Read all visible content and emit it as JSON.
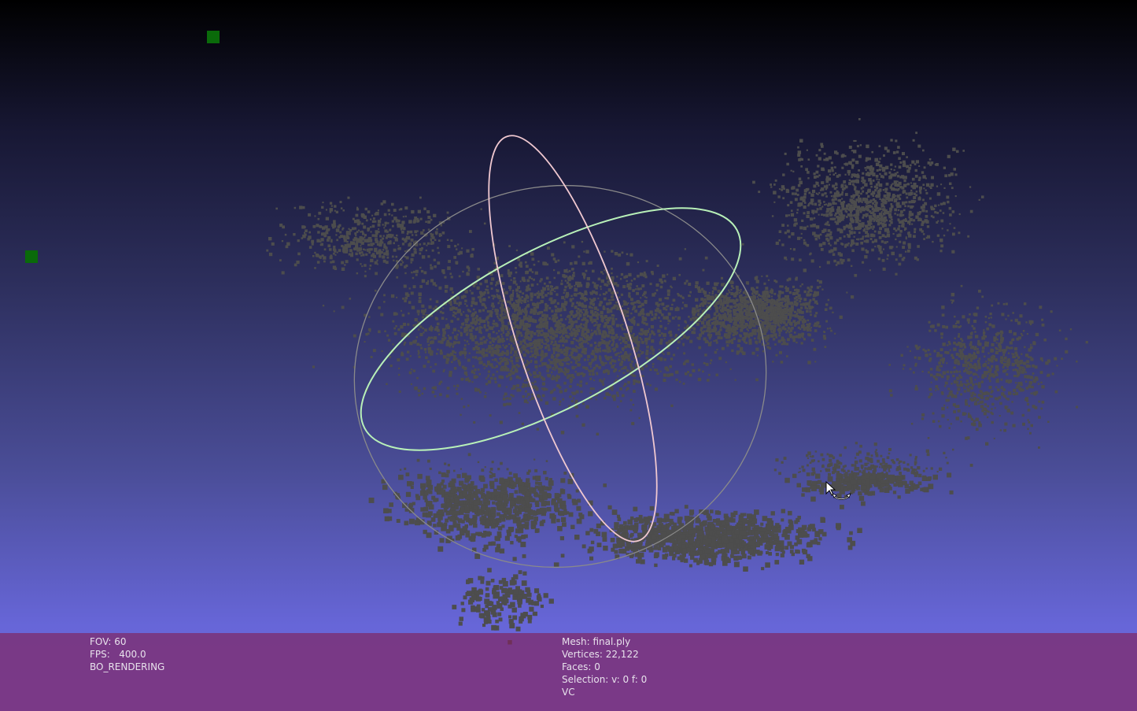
{
  "app": "MeshLab 3D viewer",
  "viewport": {
    "point_color": "#4d4d4d",
    "background_top": "#000000",
    "background_bottom": "#6e67dd",
    "trackball": {
      "horizontal_ring_color": "#b8f0b8",
      "vertical_ring_color": "#f0c8d0",
      "outer_ring_color": "#8a8a8a"
    },
    "camera_markers_color": "#0a6a0a",
    "cursor": "rotate-cursor-icon"
  },
  "info_left": {
    "fov": "FOV: 60",
    "fps": "FPS:   400.0",
    "mode": "BO_RENDERING"
  },
  "info_right": {
    "mesh": "Mesh: final.ply",
    "vertices": "Vertices: 22,122",
    "faces": "Faces: 0",
    "selection": "Selection: v: 0 f: 0",
    "color_mode": "VC"
  },
  "info_bar_color": "#7e2f6e"
}
